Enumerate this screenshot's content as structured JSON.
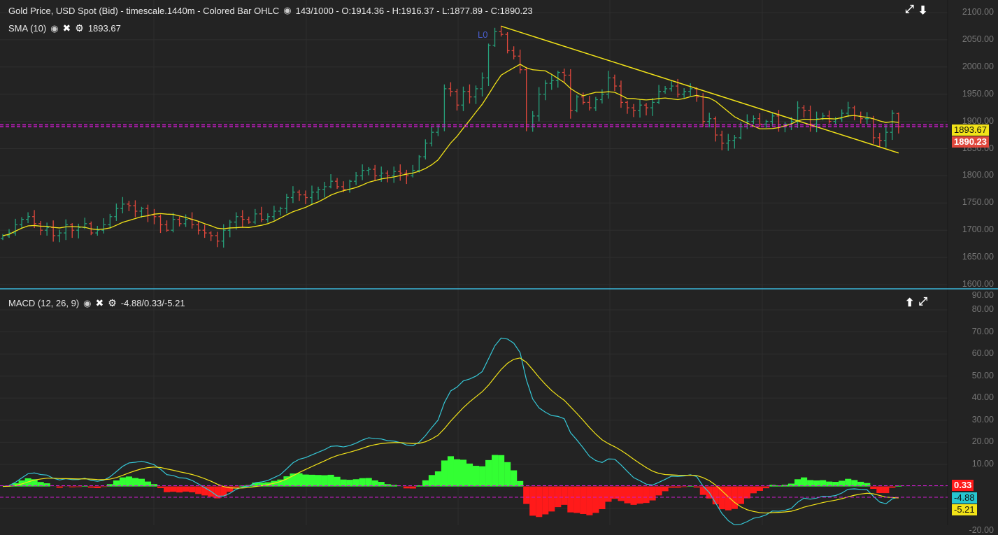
{
  "header": {
    "title": "Gold Price, USD Spot (Bid) - timescale.1440m - Colored Bar OHLC",
    "ohlc_readout": "143/1000 - O:1914.36 - H:1916.37 - L:1877.89 - C:1890.23"
  },
  "sma_legend": {
    "label": "SMA (10)",
    "value": "1893.67"
  },
  "macd_legend": {
    "label": "MACD (12, 26, 9)",
    "value": "-4.88/0.33/-5.21"
  },
  "annotations": {
    "trendline_label": "L0"
  },
  "price_tags": {
    "sma": "1893.67",
    "close": "1890.23"
  },
  "macd_tags": {
    "histogram": "0.33",
    "macd": "-4.88",
    "signal": "-5.21"
  },
  "colors": {
    "up": "#26a17b",
    "down": "#e0473c",
    "sma": "#f2e318",
    "macd": "#35c7d6",
    "signal": "#f2e318",
    "hist_up": "#33ff33",
    "hist_down": "#ff1a1a",
    "separator": "#3ab4d8"
  },
  "chart_data": [
    {
      "type": "ohlc",
      "title": "Gold Price, USD Spot (Bid)",
      "ylim": [
        1600,
        2100
      ],
      "yticks": [
        "2100.00",
        "2050.00",
        "2000.00",
        "1950.00",
        "1900.00",
        "1850.00",
        "1800.00",
        "1750.00",
        "1700.00",
        "1650.00",
        "1600.00"
      ],
      "last": {
        "open": 1914.36,
        "high": 1916.37,
        "low": 1877.89,
        "close": 1890.23
      },
      "close": [
        1690,
        1695,
        1710,
        1720,
        1725,
        1712,
        1700,
        1705,
        1690,
        1695,
        1710,
        1700,
        1705,
        1712,
        1695,
        1700,
        1710,
        1725,
        1740,
        1748,
        1745,
        1735,
        1740,
        1728,
        1725,
        1710,
        1700,
        1720,
        1712,
        1720,
        1710,
        1700,
        1695,
        1690,
        1680,
        1700,
        1715,
        1725,
        1720,
        1715,
        1730,
        1720,
        1725,
        1735,
        1740,
        1760,
        1770,
        1765,
        1760,
        1770,
        1775,
        1780,
        1790,
        1780,
        1775,
        1790,
        1800,
        1810,
        1812,
        1800,
        1805,
        1800,
        1808,
        1805,
        1800,
        1810,
        1835,
        1860,
        1880,
        1890,
        1960,
        1955,
        1930,
        1955,
        1945,
        1960,
        1980,
        2040,
        2065,
        2060,
        2030,
        2020,
        1995,
        1890,
        1910,
        1950,
        1970,
        1975,
        1990,
        1985,
        1920,
        1945,
        1935,
        1925,
        1940,
        1950,
        1980,
        1965,
        1935,
        1925,
        1920,
        1930,
        1925,
        1935,
        1955,
        1960,
        1965,
        1950,
        1955,
        1960,
        1945,
        1900,
        1905,
        1875,
        1860,
        1865,
        1870,
        1890,
        1900,
        1905,
        1895,
        1900,
        1910,
        1890,
        1895,
        1900,
        1925,
        1920,
        1895,
        1905,
        1910,
        1900,
        1905,
        1915,
        1925,
        1910,
        1905,
        1905,
        1870,
        1865,
        1880,
        1915,
        1890.23
      ],
      "sma_period": 10,
      "sma_last": 1893.67,
      "trendline": {
        "label": "L0",
        "from": [
          79,
          2075
        ],
        "to": [
          142,
          1842
        ]
      }
    },
    {
      "type": "macd",
      "params": [
        12,
        26,
        9
      ],
      "ylim": [
        -20,
        90
      ],
      "yticks": [
        "90.00",
        "80.00",
        "70.00",
        "60.00",
        "50.00",
        "40.00",
        "30.00",
        "20.00",
        "10.00",
        "-20.00"
      ],
      "last": {
        "macd": -4.88,
        "histogram": 0.33,
        "signal": -5.21
      }
    }
  ]
}
